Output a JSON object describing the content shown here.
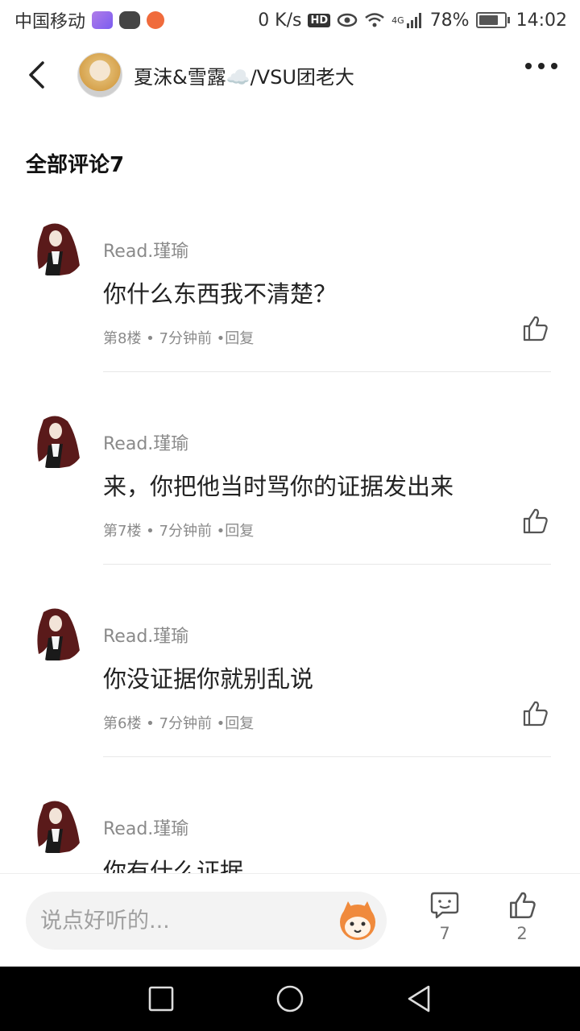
{
  "status_bar": {
    "carrier": "中国移动",
    "speed": "0 K/s",
    "hd": "HD",
    "network": "4G",
    "battery": "78%",
    "battery_level": 0.78,
    "time": "14:02"
  },
  "header": {
    "author_name": "夏沫&雪露☁️/VSU团老大",
    "icons": [
      "back-arrow-icon",
      "more-dots-icon"
    ]
  },
  "section_title": "全部评论7",
  "comments": [
    {
      "name": "Read.瑾瑜",
      "text": "你什么东西我不清楚？",
      "meta": "第8楼 • 7分钟前 •回复"
    },
    {
      "name": "Read.瑾瑜",
      "text": "来，你把他当时骂你的证据发出来",
      "meta": "第7楼 • 7分钟前 •回复"
    },
    {
      "name": "Read.瑾瑜",
      "text": "你没证据你就别乱说",
      "meta": "第6楼 • 7分钟前 •回复"
    },
    {
      "name": "Read.瑾瑜",
      "text": "你有什么证据",
      "meta": ""
    }
  ],
  "bottom_bar": {
    "input_placeholder": "说点好听的...",
    "comment_count": "7",
    "like_count": "2"
  },
  "colors": {
    "meta_gray": "#8a8a8a",
    "divider": "#e8e8e8",
    "input_bg": "#f3f3f3",
    "emoji_orange": "#f08a3c"
  }
}
